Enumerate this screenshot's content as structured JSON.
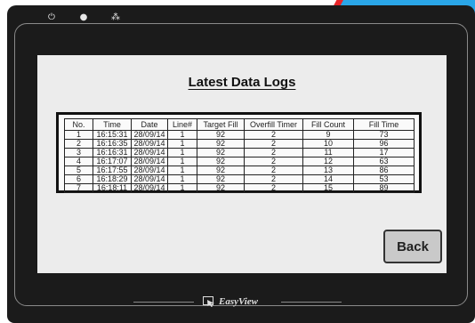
{
  "screen": {
    "title": "Latest Data Logs",
    "table": {
      "columns": [
        "No.",
        "Time",
        "Date",
        "Line#",
        "Target Fill",
        "Overfill Timer",
        "Fill Count",
        "Fill Time"
      ],
      "rows": [
        [
          "1",
          "16:15:31",
          "28/09/14",
          "1",
          "92",
          "2",
          "9",
          "73"
        ],
        [
          "2",
          "16:16:35",
          "28/09/14",
          "1",
          "92",
          "2",
          "10",
          "96"
        ],
        [
          "3",
          "16:16:31",
          "28/09/14",
          "1",
          "92",
          "2",
          "11",
          "17"
        ],
        [
          "4",
          "16:17:07",
          "28/09/14",
          "1",
          "92",
          "2",
          "12",
          "63"
        ],
        [
          "5",
          "16:17:55",
          "28/09/14",
          "1",
          "92",
          "2",
          "13",
          "86"
        ],
        [
          "6",
          "16:18:29",
          "28/09/14",
          "1",
          "92",
          "2",
          "14",
          "53"
        ],
        [
          "7",
          "16:18:11",
          "28/09/14",
          "1",
          "92",
          "2",
          "15",
          "89"
        ]
      ]
    },
    "back_label": "Back"
  },
  "bezel": {
    "indicators": [
      {
        "icon": "power-icon",
        "glyph": "⏻"
      },
      {
        "icon": "status-dot-icon",
        "glyph": "●"
      },
      {
        "icon": "network-icon",
        "glyph": "⁂"
      }
    ],
    "brand": "EasyView"
  },
  "colors": {
    "bezel": "#1b1b1b",
    "screen": "#ececec",
    "accent_red": "#e8262a",
    "accent_blue": "#2aa6e8"
  }
}
